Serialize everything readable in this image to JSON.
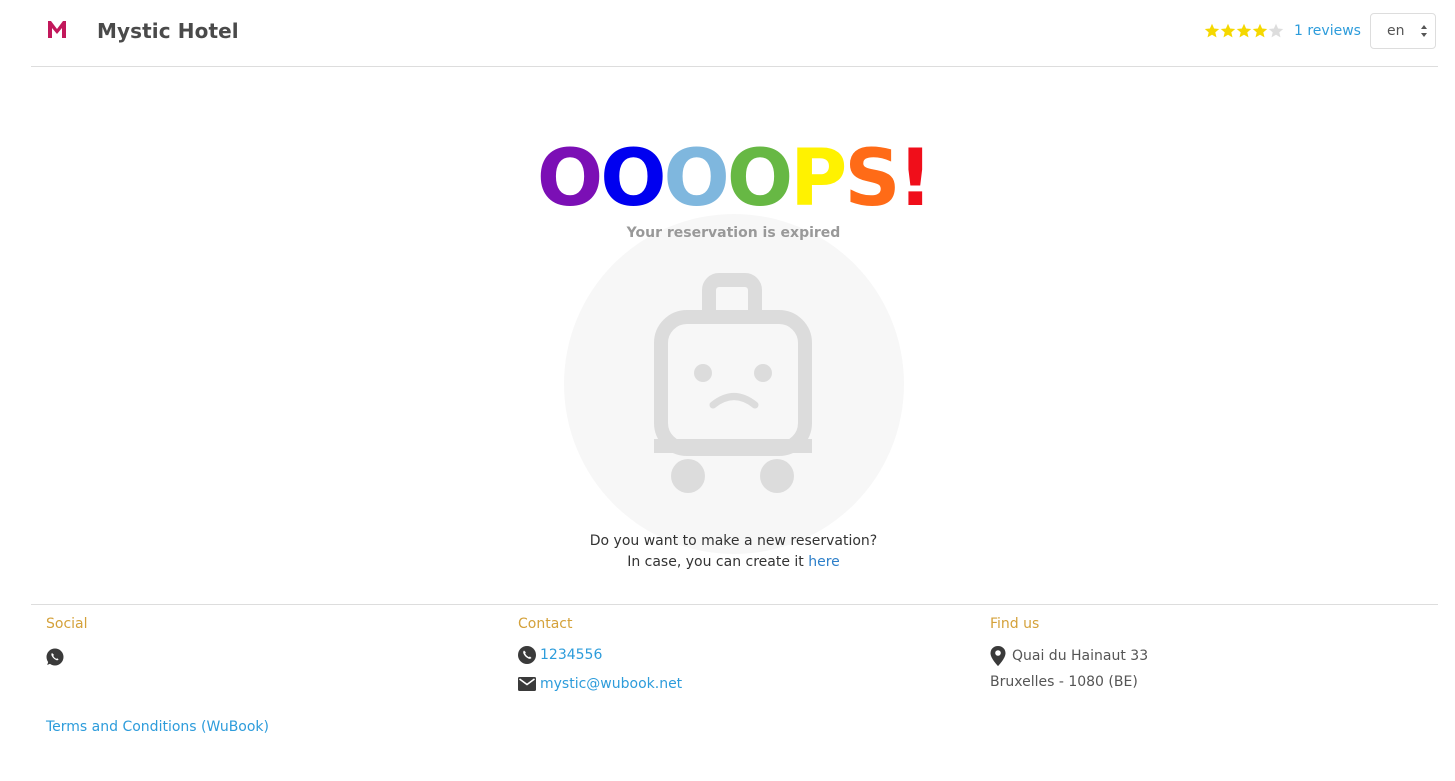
{
  "header": {
    "hotel_name": "Mystic Hotel",
    "rating_stars": 4,
    "rating_max": 5,
    "reviews_label": "1 reviews",
    "language": "en"
  },
  "main": {
    "oops_letters": [
      "O",
      "O",
      "O",
      "O",
      "P",
      "S",
      "!"
    ],
    "oops_colors": [
      "#7b0fb5",
      "#0000f0",
      "#7fb7de",
      "#67b844",
      "#fff200",
      "#ff6b17",
      "#f00e1a"
    ],
    "subtitle": "Your reservation is expired",
    "question": "Do you want to make a new reservation?",
    "create_prefix": "In case, you can create it ",
    "create_link": "here"
  },
  "footer": {
    "social_title": "Social",
    "contact_title": "Contact",
    "phone": "1234556",
    "email": "mystic@wubook.net",
    "find_title": "Find us",
    "address_line1": "Quai du Hainaut 33",
    "address_line2": "Bruxelles - 1080 (BE)",
    "terms_label": "Terms and Conditions (WuBook)"
  },
  "colors": {
    "accent_link": "#2d9cdb",
    "footer_title": "#d4a13a",
    "star_on": "#f5d800",
    "star_off": "#dddddd",
    "logo": "#c2185b"
  }
}
